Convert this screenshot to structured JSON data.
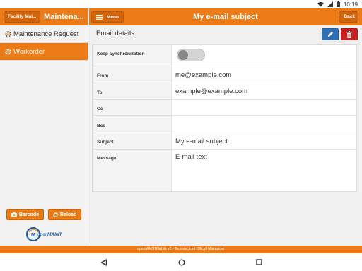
{
  "status_bar": {
    "time": "10:19"
  },
  "sidebar": {
    "back_label": "Facility Mai...",
    "title": "Maintena...",
    "items": [
      {
        "label": "Maintenance Request",
        "active": false
      },
      {
        "label": "Workorder",
        "active": true
      }
    ],
    "barcode_label": "Barcode",
    "reload_label": "Reload",
    "logo_text": "openMAINT"
  },
  "header": {
    "menu_label": "Menu",
    "title": "My e-mail subject",
    "back_label": "Back"
  },
  "section": {
    "title": "Email details"
  },
  "form": {
    "keep_sync_label": "Keep synchronization",
    "keep_sync_value": "off",
    "from_label": "From",
    "from_value": "me@example.com",
    "to_label": "To",
    "to_value": "example@example.com",
    "cc_label": "Cc",
    "cc_value": "",
    "bcc_label": "Bcc",
    "bcc_value": "",
    "subject_label": "Subject",
    "subject_value": "My e-mail subject",
    "message_label": "Message",
    "message_value": "E-mail text"
  },
  "footer": {
    "text": "openMAINTMobile v2 - Tecnoteca srl Official Maintainer"
  },
  "colors": {
    "accent": "#ec7a16",
    "edit": "#2e6fb6",
    "delete": "#cc1f1f"
  }
}
